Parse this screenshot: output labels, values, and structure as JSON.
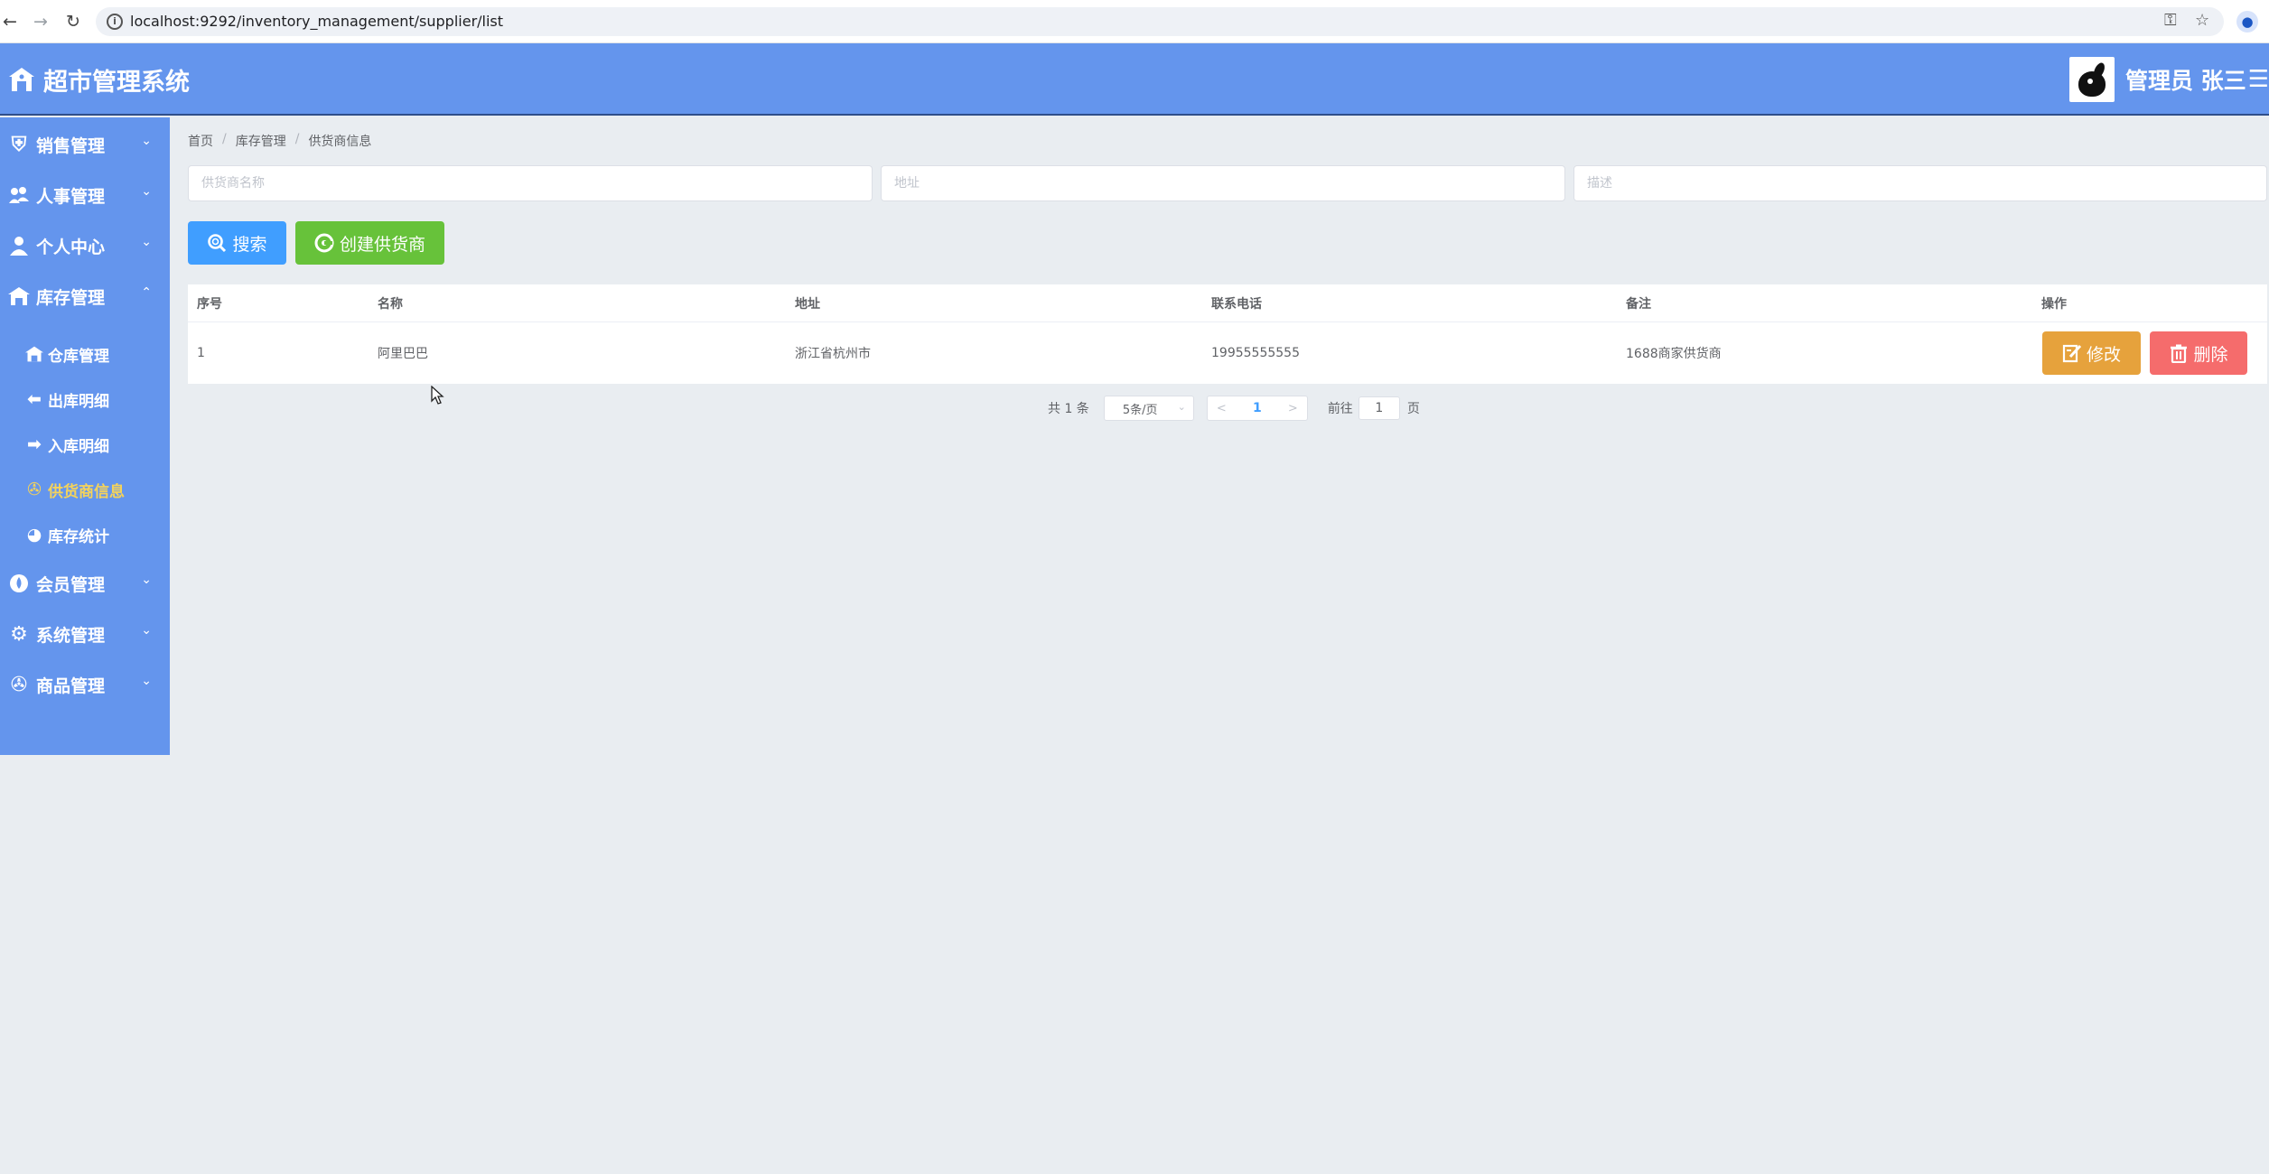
{
  "browser": {
    "url": "localhost:9292/inventory_management/supplier/list",
    "back_icon": "arrow-left-icon",
    "forward_icon": "arrow-right-icon",
    "reload_icon": "reload-icon"
  },
  "header": {
    "title": "超市管理系统",
    "user_name": "管理员 张三",
    "menu_glyph": "☰"
  },
  "sidebar": {
    "items": [
      {
        "label": "销售管理",
        "icon": "shield-user-icon"
      },
      {
        "label": "人事管理",
        "icon": "users-icon"
      },
      {
        "label": "个人中心",
        "icon": "user-icon"
      },
      {
        "label": "库存管理",
        "icon": "warehouse-icon",
        "expanded": true
      },
      {
        "label": "会员管理",
        "icon": "drop-icon"
      },
      {
        "label": "系统管理",
        "icon": "gear-icon"
      },
      {
        "label": "商品管理",
        "icon": "film-reel-icon"
      }
    ],
    "sub_items": [
      {
        "label": "仓库管理",
        "icon": "warehouse-icon"
      },
      {
        "label": "出库明细",
        "icon": "arrow-left-icon"
      },
      {
        "label": "入库明细",
        "icon": "arrow-right-icon"
      },
      {
        "label": "供货商信息",
        "icon": "film-reel-icon",
        "active": true
      },
      {
        "label": "库存统计",
        "icon": "chart-icon"
      }
    ]
  },
  "breadcrumb": [
    "首页",
    "库存管理",
    "供货商信息"
  ],
  "search": {
    "name_placeholder": "供货商名称",
    "address_placeholder": "地址",
    "description_placeholder": "描述",
    "search_label": "搜索",
    "create_label": "创建供货商"
  },
  "table": {
    "headers": [
      "序号",
      "名称",
      "地址",
      "联系电话",
      "备注",
      "操作"
    ],
    "rows": [
      {
        "index": "1",
        "name": "阿里巴巴",
        "address": "浙江省杭州市",
        "phone": "19955555555",
        "note": "1688商家供货商"
      }
    ],
    "edit_label": "修改",
    "delete_label": "删除"
  },
  "pagination": {
    "total": "共 1 条",
    "page_size": "5条/页",
    "current_page": "1",
    "goto_prefix": "前往",
    "goto_value": "1",
    "goto_suffix": "页"
  },
  "colors": {
    "sidebar": "#6495ed",
    "primary": "#409eff",
    "success": "#67c23a",
    "warning": "#e6a23c",
    "danger": "#f56c6c"
  }
}
